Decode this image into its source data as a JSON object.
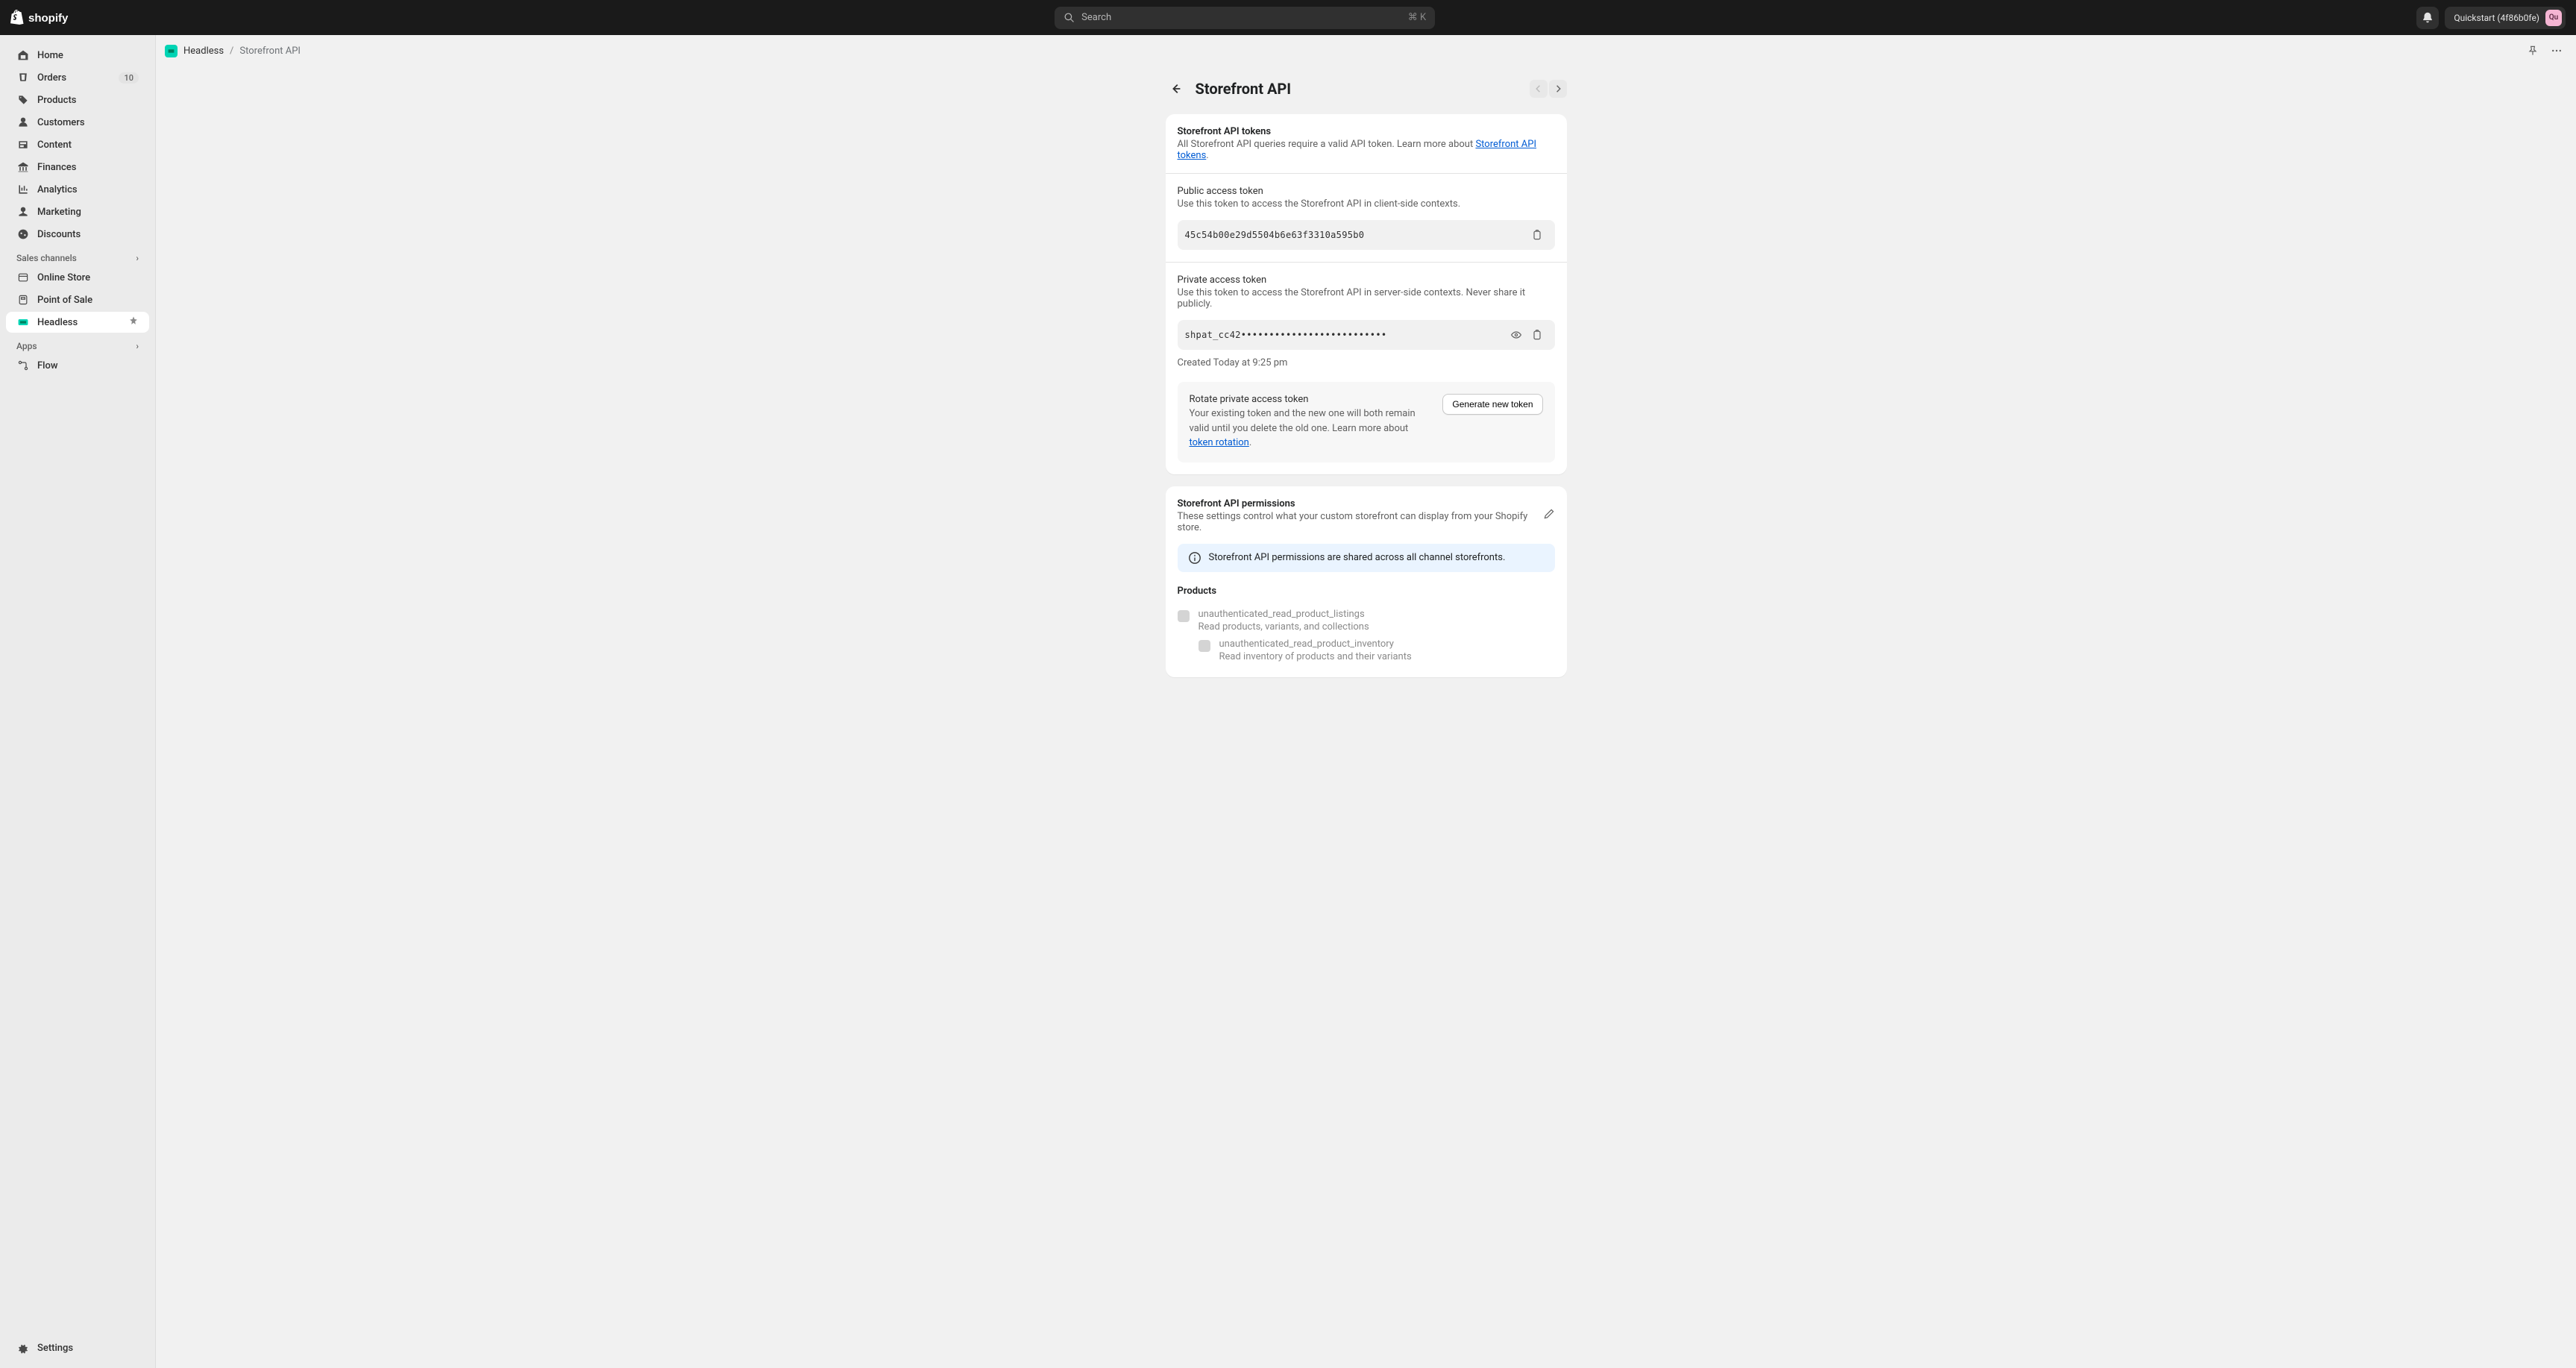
{
  "topbar": {
    "search_placeholder": "Search",
    "search_shortcut": "⌘ K",
    "store_name": "Quickstart (4f86b0fe)",
    "avatar_initials": "Qu"
  },
  "sidebar": {
    "items": {
      "home": "Home",
      "orders": "Orders",
      "orders_badge": "10",
      "products": "Products",
      "customers": "Customers",
      "content": "Content",
      "finances": "Finances",
      "analytics": "Analytics",
      "marketing": "Marketing",
      "discounts": "Discounts"
    },
    "sections": {
      "sales_channels": "Sales channels",
      "apps": "Apps"
    },
    "channels": {
      "online_store": "Online Store",
      "point_of_sale": "Point of Sale",
      "headless": "Headless"
    },
    "apps": {
      "flow": "Flow"
    },
    "settings": "Settings"
  },
  "breadcrumb": {
    "app": "Headless",
    "current": "Storefront API"
  },
  "page": {
    "title": "Storefront API"
  },
  "tokens_card": {
    "title": "Storefront API tokens",
    "subtitle_prefix": "All Storefront API queries require a valid API token. Learn more about ",
    "subtitle_link": "Storefront API tokens",
    "subtitle_suffix": ".",
    "public": {
      "label": "Public access token",
      "desc": "Use this token to access the Storefront API in client-side contexts.",
      "value": "45c54b00e29d5504b6e63f3310a595b0"
    },
    "private": {
      "label": "Private access token",
      "desc": "Use this token to access the Storefront API in server-side contexts. Never share it publicly.",
      "value": "shpat_cc42••••••••••••••••••••••••••",
      "created": "Created Today at 9:25 pm"
    },
    "rotate": {
      "title": "Rotate private access token",
      "desc_prefix": "Your existing token and the new one will both remain valid until you delete the old one. Learn more about ",
      "desc_link": "token rotation",
      "desc_suffix": ".",
      "button": "Generate new token"
    }
  },
  "permissions_card": {
    "title": "Storefront API permissions",
    "subtitle": "These settings control what your custom storefront can display from your Shopify store.",
    "banner": "Storefront API permissions are shared across all channel storefronts.",
    "products": {
      "title": "Products",
      "listings": {
        "name": "unauthenticated_read_product_listings",
        "desc": "Read products, variants, and collections"
      },
      "inventory": {
        "name": "unauthenticated_read_product_inventory",
        "desc": "Read inventory of products and their variants"
      }
    }
  }
}
